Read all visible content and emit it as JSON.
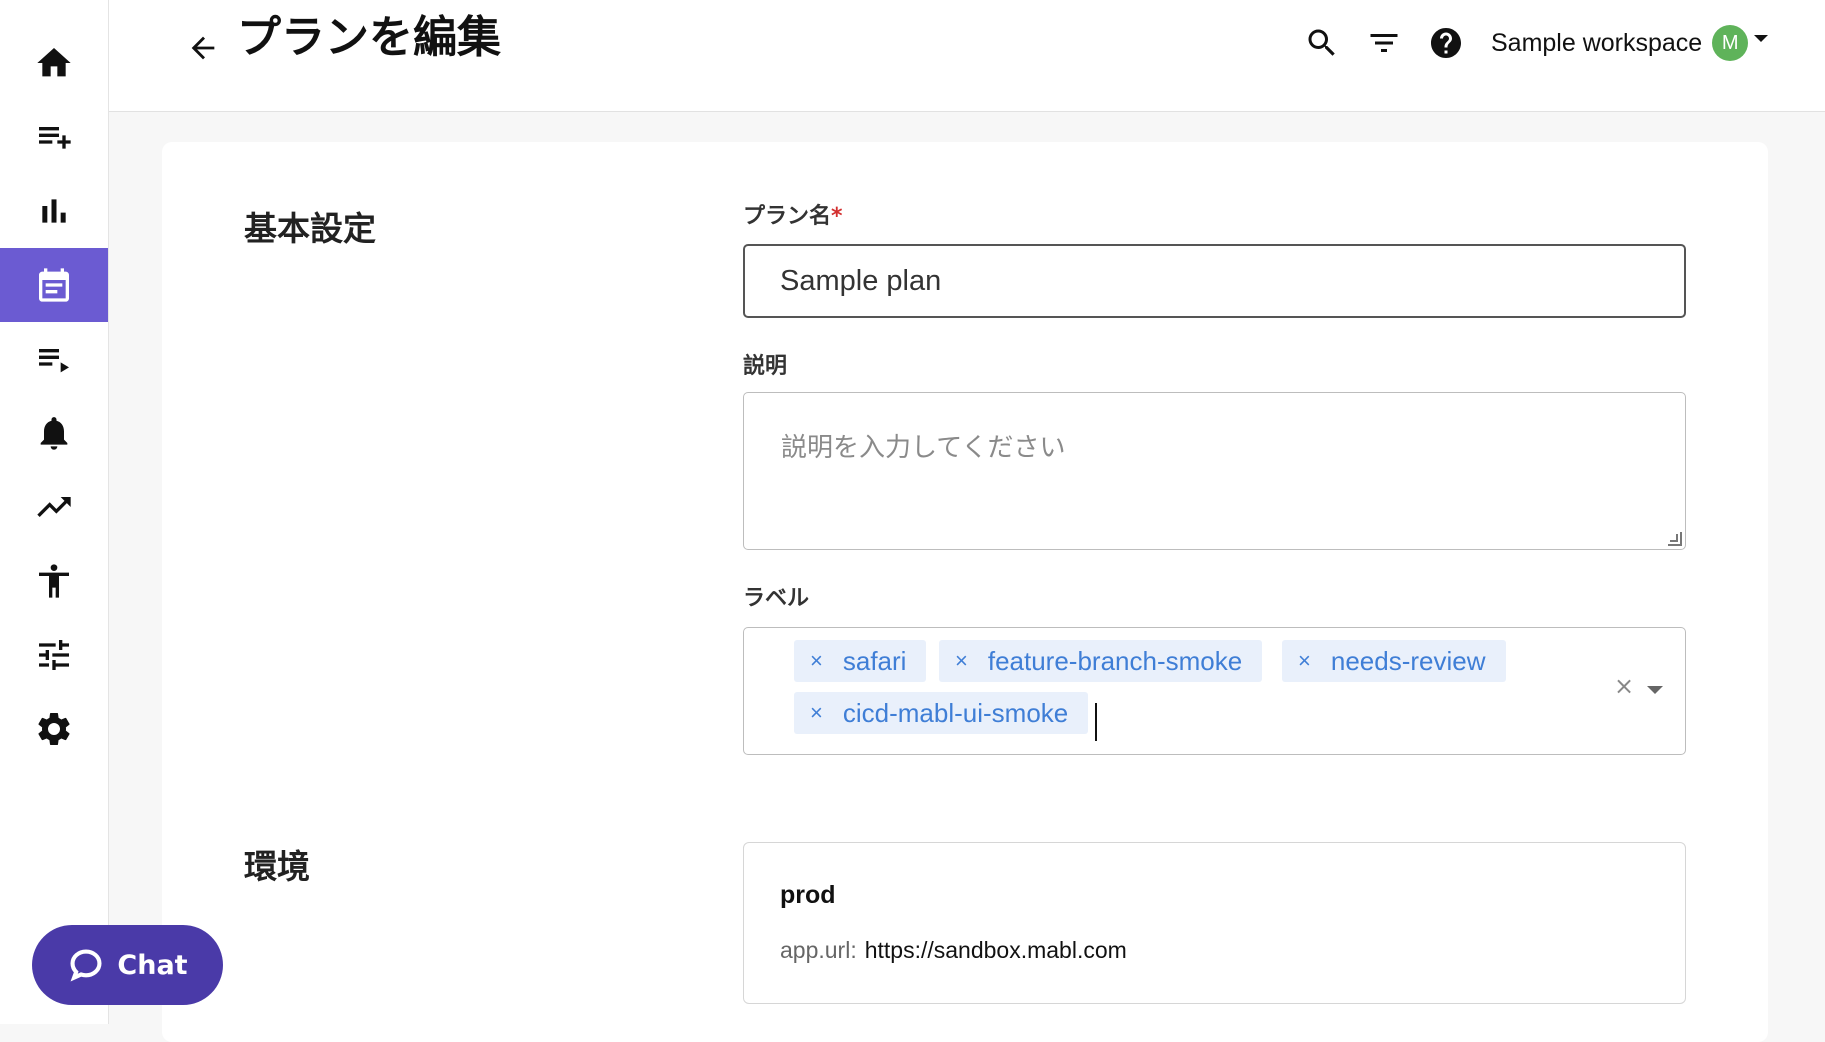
{
  "header": {
    "title": "プランを編集",
    "workspace_name": "Sample workspace",
    "avatar_initial": "M"
  },
  "sidebar": {
    "items": [
      {
        "icon": "home-icon",
        "active": false
      },
      {
        "icon": "playlist-add-icon",
        "active": false
      },
      {
        "icon": "bar-chart-icon",
        "active": false
      },
      {
        "icon": "calendar-plan-icon",
        "active": true
      },
      {
        "icon": "playlist-play-icon",
        "active": false
      },
      {
        "icon": "bell-icon",
        "active": false
      },
      {
        "icon": "trending-up-icon",
        "active": false
      },
      {
        "icon": "accessibility-icon",
        "active": false
      },
      {
        "icon": "tune-icon",
        "active": false
      },
      {
        "icon": "gear-icon",
        "active": false
      }
    ]
  },
  "basic": {
    "section_title": "基本設定",
    "plan_name_label": "プラン名",
    "required_mark": "*",
    "plan_name_value": "Sample plan",
    "description_label": "説明",
    "description_placeholder": "説明を入力してください",
    "labels_label": "ラベル",
    "labels": [
      "safari",
      "feature-branch-smoke",
      "needs-review",
      "cicd-mabl-ui-smoke"
    ],
    "chip_remove": "×",
    "clear_all": "×"
  },
  "environment": {
    "section_title": "環境",
    "name": "prod",
    "url_key": "app.url:",
    "url_value": "https://sandbox.mabl.com"
  },
  "chat": {
    "label": "Chat"
  },
  "colors": {
    "accent": "#6b5bd2",
    "chat_bg": "#4a3aa8",
    "chip_bg": "#e9f0fb",
    "chip_text": "#3f7ed6",
    "avatar_bg": "#5fb35a"
  }
}
